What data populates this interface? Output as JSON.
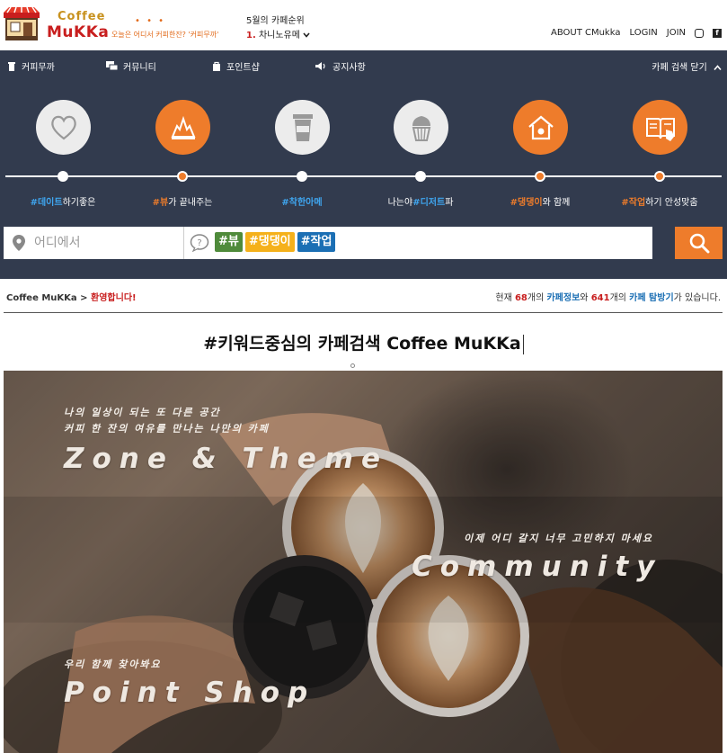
{
  "header": {
    "logo_top": "Coffee",
    "logo_main": "MuKKa",
    "dots": "• • •",
    "tagline": "오늘은 어디서 커피한잔? '커피무까'",
    "rank_title": "5월의 카페순위",
    "rank_num": "1.",
    "rank_name": "차니노유메",
    "links": [
      "ABOUT CMukka",
      "LOGIN",
      "JOIN"
    ]
  },
  "nav": {
    "items": [
      "커피무까",
      "커뮤니티",
      "포인트샵",
      "공지사항"
    ],
    "right": "카페 검색 닫기"
  },
  "hero": {
    "tags": [
      {
        "pre": "",
        "hl": "#데이트",
        "post": "하기좋은",
        "color": "blue"
      },
      {
        "pre": "",
        "hl": "#뷰",
        "post": "가 끝내주는",
        "color": "orange"
      },
      {
        "pre": "",
        "hl": "#착한아메",
        "post": "",
        "color": "blue"
      },
      {
        "pre": "나는야",
        "hl": "#디저트",
        "post": "파",
        "color": "blue"
      },
      {
        "pre": "",
        "hl": "#댕댕이",
        "post": "와 함께",
        "color": "orange"
      },
      {
        "pre": "",
        "hl": "#작업",
        "post": "하기 안성맞춤",
        "color": "orange"
      }
    ],
    "location_placeholder": "어디에서",
    "search_tags": [
      "#뷰",
      "#댕댕이",
      "#작업"
    ]
  },
  "crumb": {
    "site": "Coffee MuKKa",
    "sep": " > ",
    "welcome": "환영합니다!"
  },
  "stats": {
    "p1": "현재 ",
    "cafes": "68",
    "p2": "개의 ",
    "info": "카페정보",
    "p3": "와 ",
    "visits": "641",
    "p4": "개의 ",
    "explore": "카페 탐방기",
    "p5": "가 있습니다."
  },
  "headline": "#키워드중심의 카페검색 Coffee MuKKa",
  "banner": {
    "zone_sub1": "나의 일상이 되는 또 다른 공간",
    "zone_sub2": "커피 한 잔의 여유를 만나는 나만의 카페",
    "zone_title": "Zone & Theme",
    "community_sub": "이제 어디 갈지 너무 고민하지 마세요",
    "community_title": "Community",
    "point_sub": "우리 함께 찾아봐요",
    "point_title": "Point Shop"
  }
}
